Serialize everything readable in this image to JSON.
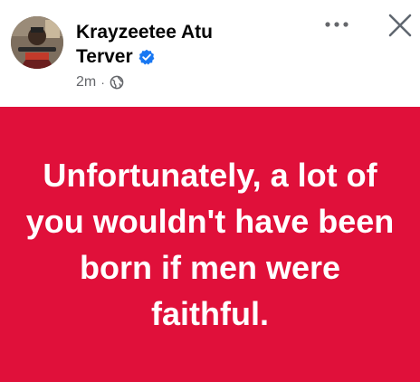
{
  "post": {
    "author_line1": "Krayzeetee Atu",
    "author_line2": "Terver",
    "timestamp": "2m",
    "separator": "·",
    "audience_icon": "globe-icon",
    "verified_icon": "verified-badge-icon",
    "text": "Unfortunately, a lot of you wouldn't have been born if men were faithful."
  },
  "actions": {
    "more_icon": "more-options-icon",
    "close_icon": "close-icon"
  },
  "colors": {
    "card_background": "#e0103a",
    "card_text": "#ffffff",
    "verified_blue": "#1877f2",
    "meta_gray": "#65676b"
  }
}
